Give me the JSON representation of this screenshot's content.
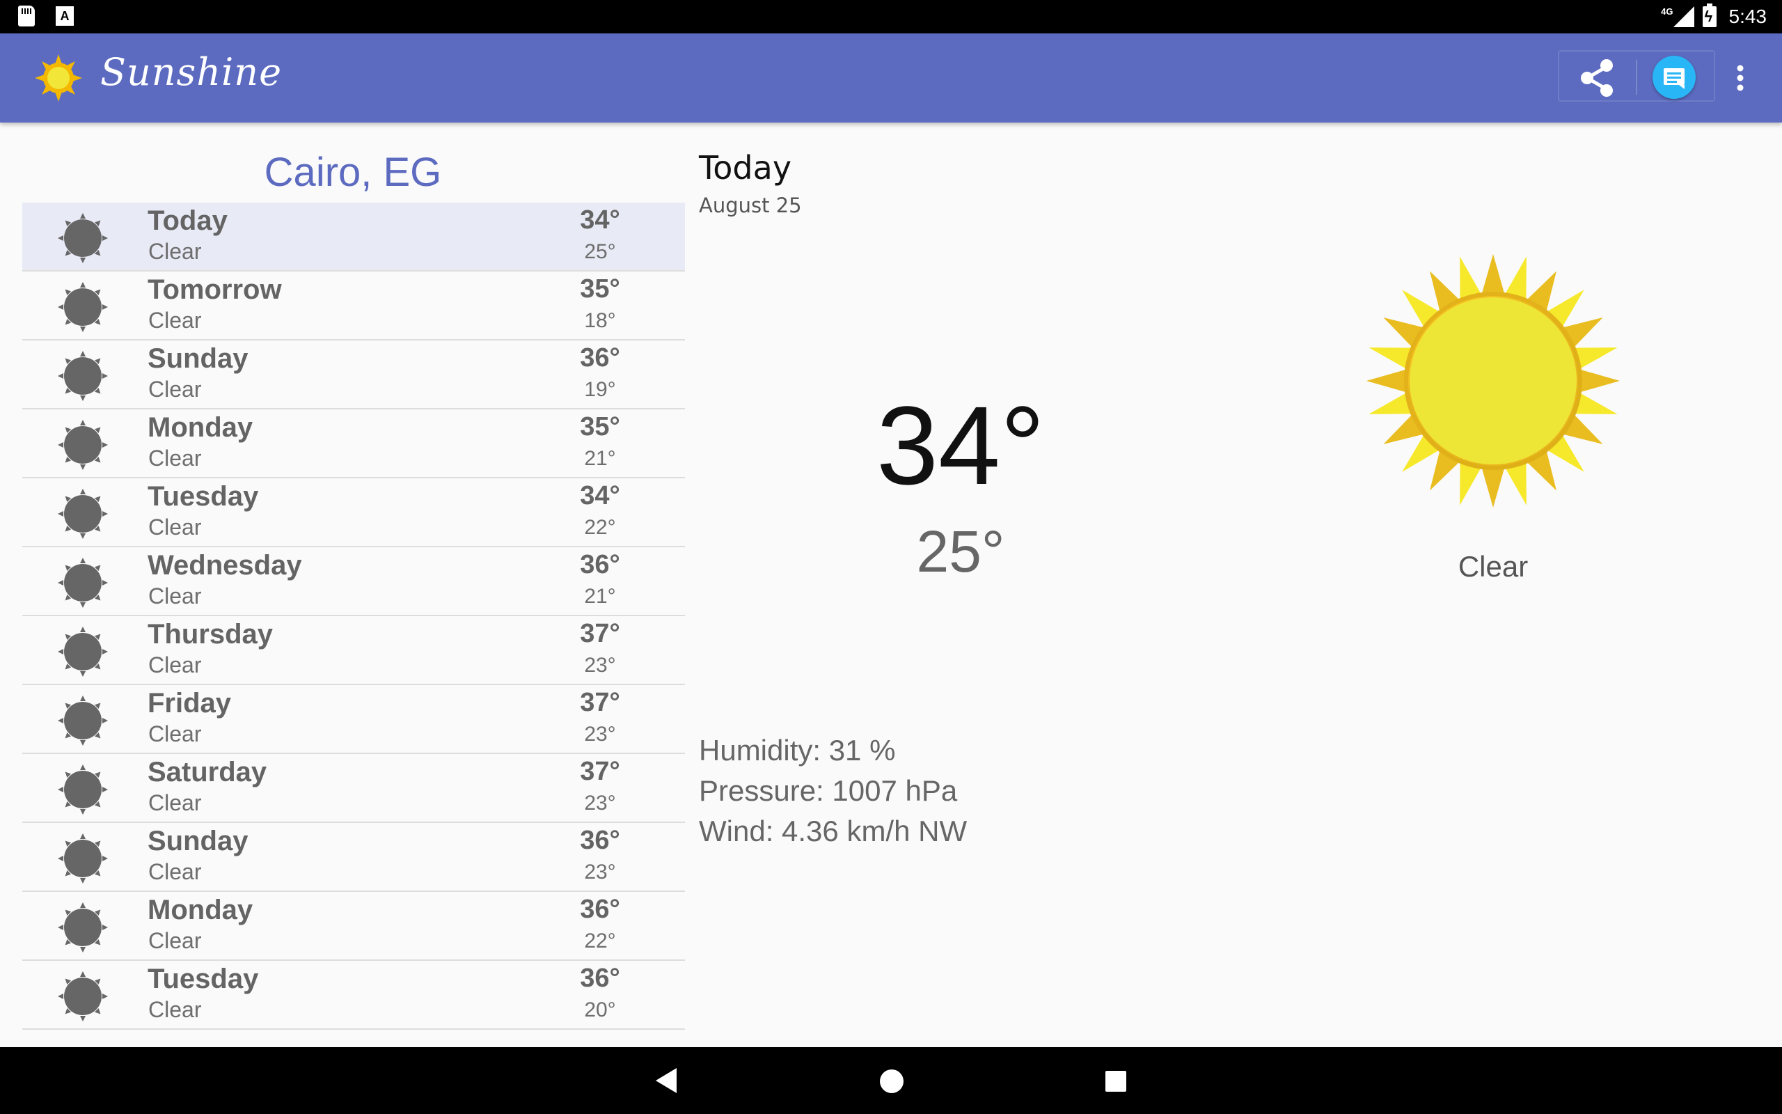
{
  "status_bar": {
    "network": "4G",
    "time": "5:43"
  },
  "app_bar": {
    "title": "Sunshine",
    "icons": [
      "sun-logo-icon",
      "share-icon",
      "message-icon",
      "overflow-menu-icon"
    ],
    "color": "#5c6bc0"
  },
  "forecast": {
    "location": "Cairo, EG",
    "items": [
      {
        "day": "Today",
        "desc": "Clear",
        "high": "34°",
        "low": "25°"
      },
      {
        "day": "Tomorrow",
        "desc": "Clear",
        "high": "35°",
        "low": "18°"
      },
      {
        "day": "Sunday",
        "desc": "Clear",
        "high": "36°",
        "low": "19°"
      },
      {
        "day": "Monday",
        "desc": "Clear",
        "high": "35°",
        "low": "21°"
      },
      {
        "day": "Tuesday",
        "desc": "Clear",
        "high": "34°",
        "low": "22°"
      },
      {
        "day": "Wednesday",
        "desc": "Clear",
        "high": "36°",
        "low": "21°"
      },
      {
        "day": "Thursday",
        "desc": "Clear",
        "high": "37°",
        "low": "23°"
      },
      {
        "day": "Friday",
        "desc": "Clear",
        "high": "37°",
        "low": "23°"
      },
      {
        "day": "Saturday",
        "desc": "Clear",
        "high": "37°",
        "low": "23°"
      },
      {
        "day": "Sunday",
        "desc": "Clear",
        "high": "36°",
        "low": "23°"
      },
      {
        "day": "Monday",
        "desc": "Clear",
        "high": "36°",
        "low": "22°"
      },
      {
        "day": "Tuesday",
        "desc": "Clear",
        "high": "36°",
        "low": "20°"
      }
    ]
  },
  "detail": {
    "day": "Today",
    "date": "August 25",
    "high": "34°",
    "low": "25°",
    "description": "Clear",
    "humidity": "Humidity: 31 %",
    "pressure": "Pressure: 1007 hPa",
    "wind": "Wind: 4.36 km/h NW"
  }
}
